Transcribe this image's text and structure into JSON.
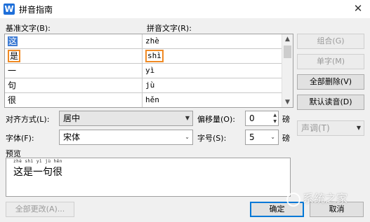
{
  "window": {
    "title": "拼音指南",
    "app_icon_glyph": "W",
    "close_glyph": "✕"
  },
  "labels": {
    "base_text": "基准文字(B):",
    "pinyin_text": "拼音文字(R):",
    "alignment": "对齐方式(L):",
    "offset": "偏移量(O):",
    "font": "字体(F):",
    "size": "字号(S):",
    "unit": "磅",
    "preview": "预览"
  },
  "rows": [
    {
      "base": "这",
      "pinyin": "zhè"
    },
    {
      "base": "是",
      "pinyin": "shì"
    },
    {
      "base": "一",
      "pinyin": "yì"
    },
    {
      "base": "句",
      "pinyin": "jù"
    },
    {
      "base": "很",
      "pinyin": "hěn"
    }
  ],
  "buttons": {
    "combine": "组合(G)",
    "single": "单字(M)",
    "delete_all": "全部删除(V)",
    "default_reading": "默认读音(D)",
    "tone": "声调(T)",
    "change_all": "全部更改(A)...",
    "ok": "确定",
    "cancel": "取消"
  },
  "fields": {
    "alignment_value": "居中",
    "offset_value": "0",
    "font_value": "宋体",
    "size_value": "5"
  },
  "preview": {
    "ruby": "zhè shì yì jù hěn",
    "text": "这是一句很"
  },
  "watermark": {
    "text": "系统之家"
  },
  "colors": {
    "highlight_border": "#f08a24",
    "selection": "#3d7bd4",
    "app_icon": "#1e6fd9"
  }
}
